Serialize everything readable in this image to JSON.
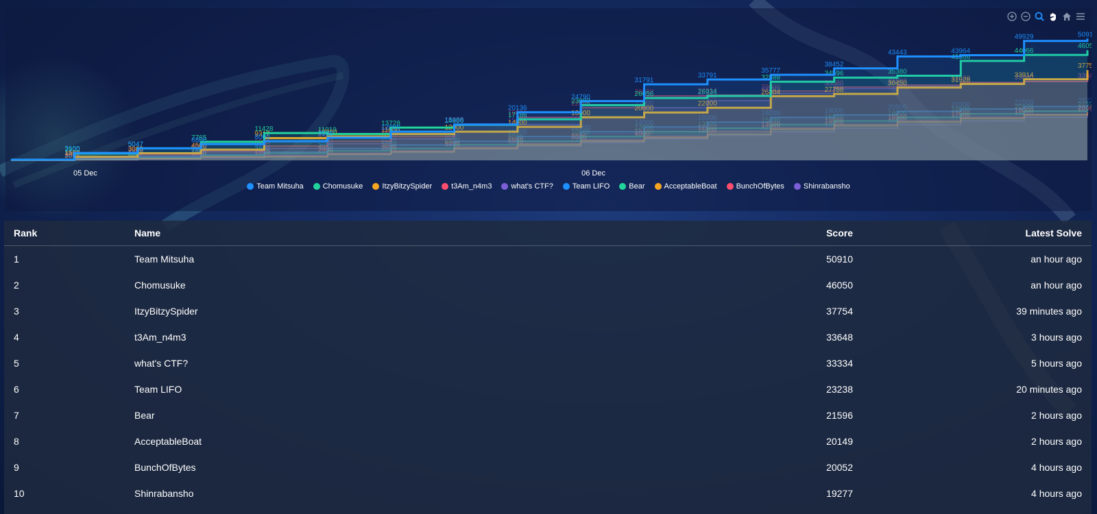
{
  "theme": {
    "series_colors": [
      "#1e90ff",
      "#22d39b",
      "#f5a623",
      "#ff4d6d",
      "#7c5fd6",
      "#1e90ff",
      "#22d39b",
      "#f5a623",
      "#ff4d6d",
      "#7c5fd6"
    ]
  },
  "toolbar": {
    "icons": [
      "zoom-in-icon",
      "zoom-out-icon",
      "selection-zoom-icon",
      "pan-hand-icon",
      "reset-home-icon",
      "menu-icon"
    ]
  },
  "chart_data": {
    "type": "area",
    "x_tick_labels": [
      "05 Dec",
      "06 Dec"
    ],
    "legend": [
      "Team Mitsuha",
      "Chomusuke",
      "ItzyBitzySpider",
      "t3Am_n4m3",
      "what's CTF?",
      "Team LIFO",
      "Bear",
      "AcceptableBoat",
      "BunchOfBytes",
      "Shinrabansho"
    ],
    "series": [
      {
        "name": "Team Mitsuha",
        "values": [
          250,
          3100,
          5047,
          6800,
          8000,
          9500,
          12000,
          15000,
          20136,
          24790,
          31791,
          33791,
          35777,
          38452,
          43443,
          43964,
          49929,
          50910
        ]
      },
      {
        "name": "Chomusuke",
        "values": [
          250,
          2900,
          5047,
          7765,
          11428,
          11019,
          13728,
          14856,
          17186,
          23082,
          26056,
          26934,
          32888,
          34596,
          35380,
          41566,
          44066,
          46050
        ]
      },
      {
        "name": "ItzyBitzySpider",
        "values": [
          200,
          1500,
          3000,
          4500,
          9317,
          10000,
          11000,
          12000,
          14000,
          18000,
          20000,
          22000,
          26804,
          27788,
          30450,
          31928,
          33914,
          37754
        ]
      },
      {
        "name": "t3Am_n4m3",
        "values": [
          200,
          1200,
          2500,
          4000,
          6000,
          8000,
          10000,
          15128,
          18000,
          22000,
          26998,
          27314,
          29000,
          30680,
          31500,
          32620,
          33000,
          33648
        ]
      },
      {
        "name": "what's CTF?",
        "values": [
          150,
          1000,
          2000,
          3500,
          5000,
          7000,
          9000,
          12000,
          15000,
          18000,
          22000,
          25000,
          28000,
          30000,
          31000,
          32000,
          33000,
          33334
        ]
      },
      {
        "name": "Team LIFO",
        "values": [
          100,
          600,
          1500,
          2500,
          3500,
          5000,
          6500,
          8000,
          10000,
          12000,
          14000,
          16000,
          18000,
          19000,
          20500,
          21500,
          22500,
          23238
        ]
      },
      {
        "name": "Bear",
        "values": [
          100,
          500,
          1200,
          2000,
          3000,
          4000,
          5000,
          6500,
          8000,
          10000,
          12000,
          13500,
          15000,
          16500,
          18000,
          19500,
          20600,
          21596
        ]
      },
      {
        "name": "AcceptableBoat",
        "values": [
          0,
          300,
          800,
          1600,
          1450,
          2500,
          3500,
          5000,
          6500,
          8000,
          9500,
          11000,
          13000,
          14500,
          16000,
          17500,
          19000,
          20149
        ]
      },
      {
        "name": "BunchOfBytes",
        "values": [
          0,
          250,
          700,
          1300,
          2000,
          3000,
          4000,
          5500,
          7000,
          8500,
          10000,
          12000,
          13500,
          15000,
          16500,
          18000,
          19200,
          20052
        ]
      },
      {
        "name": "Shinrabansho",
        "values": [
          0,
          200,
          600,
          1100,
          1800,
          2600,
          3500,
          4800,
          6000,
          7500,
          9000,
          10500,
          12000,
          13500,
          15000,
          16500,
          18000,
          19277
        ]
      }
    ],
    "ylim": [
      0,
      55000
    ],
    "legend_position": "bottom-center",
    "grid": false
  },
  "table": {
    "headers": {
      "rank": "Rank",
      "name": "Name",
      "score": "Score",
      "latest": "Latest Solve"
    },
    "rows": [
      {
        "rank": "1",
        "name": "Team Mitsuha",
        "score": "50910",
        "latest": "an hour ago"
      },
      {
        "rank": "2",
        "name": "Chomusuke",
        "score": "46050",
        "latest": "an hour ago"
      },
      {
        "rank": "3",
        "name": "ItzyBitzySpider",
        "score": "37754",
        "latest": "39 minutes ago"
      },
      {
        "rank": "4",
        "name": "t3Am_n4m3",
        "score": "33648",
        "latest": "3 hours ago"
      },
      {
        "rank": "5",
        "name": "what's CTF?",
        "score": "33334",
        "latest": "5 hours ago"
      },
      {
        "rank": "6",
        "name": "Team LIFO",
        "score": "23238",
        "latest": "20 minutes ago"
      },
      {
        "rank": "7",
        "name": "Bear",
        "score": "21596",
        "latest": "2 hours ago"
      },
      {
        "rank": "8",
        "name": "AcceptableBoat",
        "score": "20149",
        "latest": "2 hours ago"
      },
      {
        "rank": "9",
        "name": "BunchOfBytes",
        "score": "20052",
        "latest": "4 hours ago"
      },
      {
        "rank": "10",
        "name": "Shinrabansho",
        "score": "19277",
        "latest": "4 hours ago"
      }
    ]
  }
}
